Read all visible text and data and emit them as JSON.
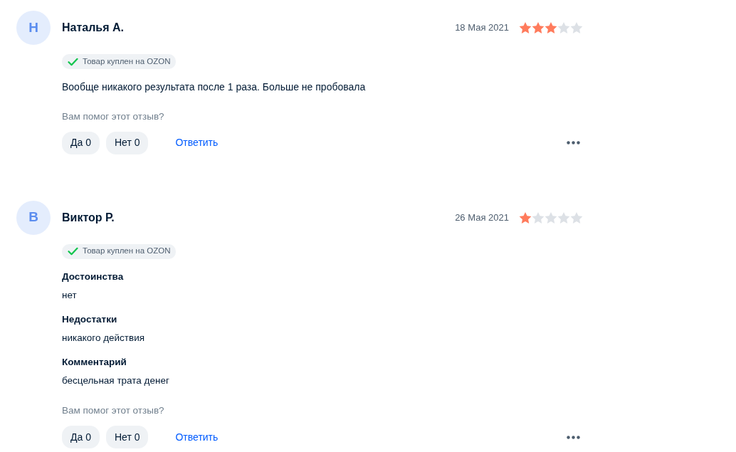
{
  "reviews": [
    {
      "avatar_letter": "Н",
      "author": "Наталья А.",
      "date": "18 Мая 2021",
      "stars": 3,
      "badge": "Товар куплен на OZON",
      "sections": [
        {
          "kind": "text",
          "text": "Вообще никакого результата после 1 раза. Больше не пробовала"
        }
      ],
      "helpful_question": "Вам помог этот отзыв?",
      "yes_button": "Да 0",
      "no_button": "Нет 0",
      "reply_link": "Ответить"
    },
    {
      "avatar_letter": "В",
      "author": "Виктор Р.",
      "date": "26 Мая 2021",
      "stars": 1,
      "badge": "Товар куплен на OZON",
      "sections": [
        {
          "kind": "field",
          "heading": "Достоинства",
          "text": "нет"
        },
        {
          "kind": "field",
          "heading": "Недостатки",
          "text": "никакого действия"
        },
        {
          "kind": "field",
          "heading": "Комментарий",
          "text": "бесцельная трата денег"
        }
      ],
      "helpful_question": "Вам помог этот отзыв?",
      "yes_button": "Да 0",
      "no_button": "Нет 0",
      "reply_link": "Ответить"
    }
  ]
}
